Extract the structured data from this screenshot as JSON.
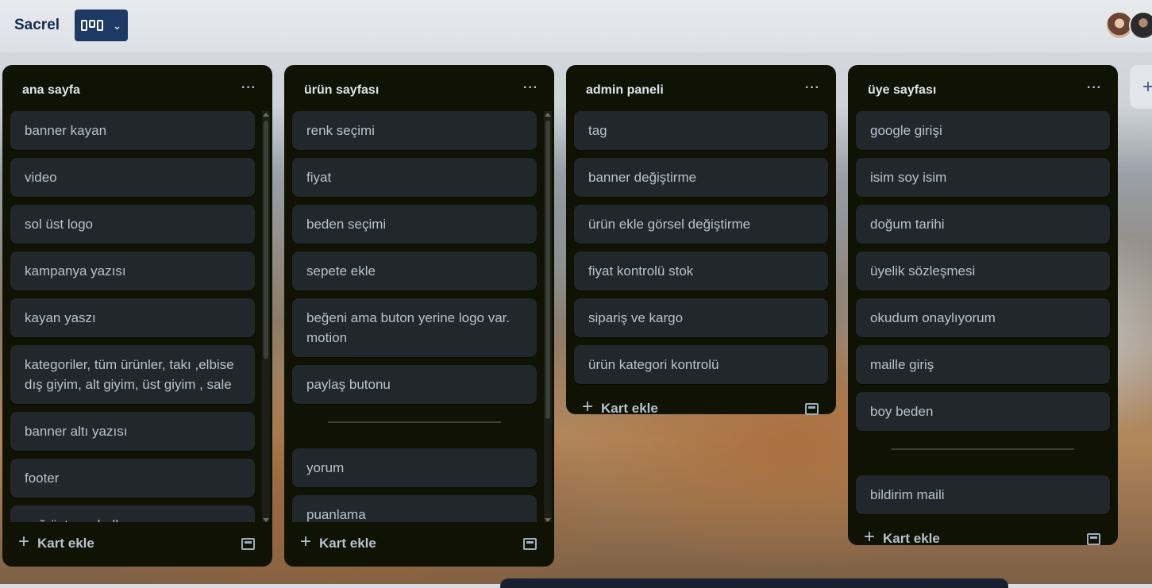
{
  "header": {
    "board_title": "Sacrel",
    "view_switch_icon": "board-icon"
  },
  "lists": [
    {
      "title": "ana sayfa",
      "cards": [
        "banner kayan",
        "video",
        "sol üst logo",
        "kampanya yazısı",
        "kayan yaszı",
        "kategoriler, tüm ürünler, takı ,elbise dış giyim, alt giyim, üst giyim , sale",
        "banner altı yazısı",
        "footer",
        "sağ üst semboller arama"
      ],
      "add_card": "Kart ekle"
    },
    {
      "title": "ürün sayfası",
      "cards": [
        "renk seçimi",
        "fiyat",
        "beden seçimi",
        "sepete ekle",
        "beğeni ama buton yerine logo var. motion",
        "paylaş butonu"
      ],
      "cards_after": [
        "yorum",
        "puanlama"
      ],
      "add_card": "Kart ekle"
    },
    {
      "title": "admin paneli",
      "cards": [
        "tag",
        "banner değiştirme",
        "ürün ekle görsel değiştirme",
        "fiyat kontrolü stok",
        "sipariş ve kargo",
        "ürün kategori kontrolü"
      ],
      "add_card": "Kart ekle"
    },
    {
      "title": "üye sayfası",
      "cards": [
        "google girişi",
        "isim soy isim",
        "doğum tarihi",
        "üyelik sözleşmesi",
        "okudum onaylıyorum",
        "maille giriş",
        "boy beden"
      ],
      "cards_after": [
        "bildirim maili"
      ],
      "add_card": "Kart ekle"
    }
  ]
}
